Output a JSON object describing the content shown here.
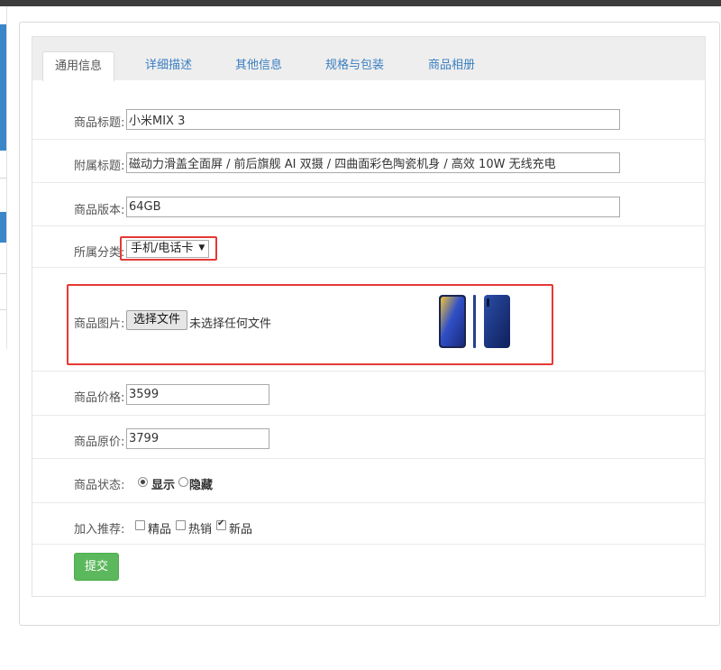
{
  "tabs": [
    {
      "label": "通用信息",
      "active": true
    },
    {
      "label": "详细描述",
      "active": false
    },
    {
      "label": "其他信息",
      "active": false
    },
    {
      "label": "规格与包装",
      "active": false
    },
    {
      "label": "商品相册",
      "active": false
    }
  ],
  "form": {
    "title_label": "商品标题:",
    "title_value": "小米MIX 3",
    "subtitle_label": "附属标题:",
    "subtitle_value": "磁动力滑盖全面屏 / 前后旗舰 AI 双摄 / 四曲面彩色陶瓷机身 / 高效 10W 无线充电",
    "version_label": "商品版本:",
    "version_value": "64GB",
    "category_label": "所属分类:",
    "category_value": "手机/电话卡",
    "image_label": "商品图片:",
    "file_button": "选择文件",
    "file_status": "未选择任何文件",
    "price_label": "商品价格:",
    "price_value": "3599",
    "orig_price_label": "商品原价:",
    "orig_price_value": "3799",
    "status_label": "商品状态:",
    "status_options": [
      {
        "label": "显示",
        "checked": true
      },
      {
        "label": "隐藏",
        "checked": false
      }
    ],
    "recommend_label": "加入推荐:",
    "recommend_options": [
      {
        "label": "精品",
        "checked": false
      },
      {
        "label": "热销",
        "checked": false
      },
      {
        "label": "新品",
        "checked": true
      }
    ],
    "submit_label": "提交"
  },
  "colors": {
    "accent_blue": "#3a7fc1",
    "submit_green": "#5cb85c",
    "highlight_red": "#e53935"
  }
}
